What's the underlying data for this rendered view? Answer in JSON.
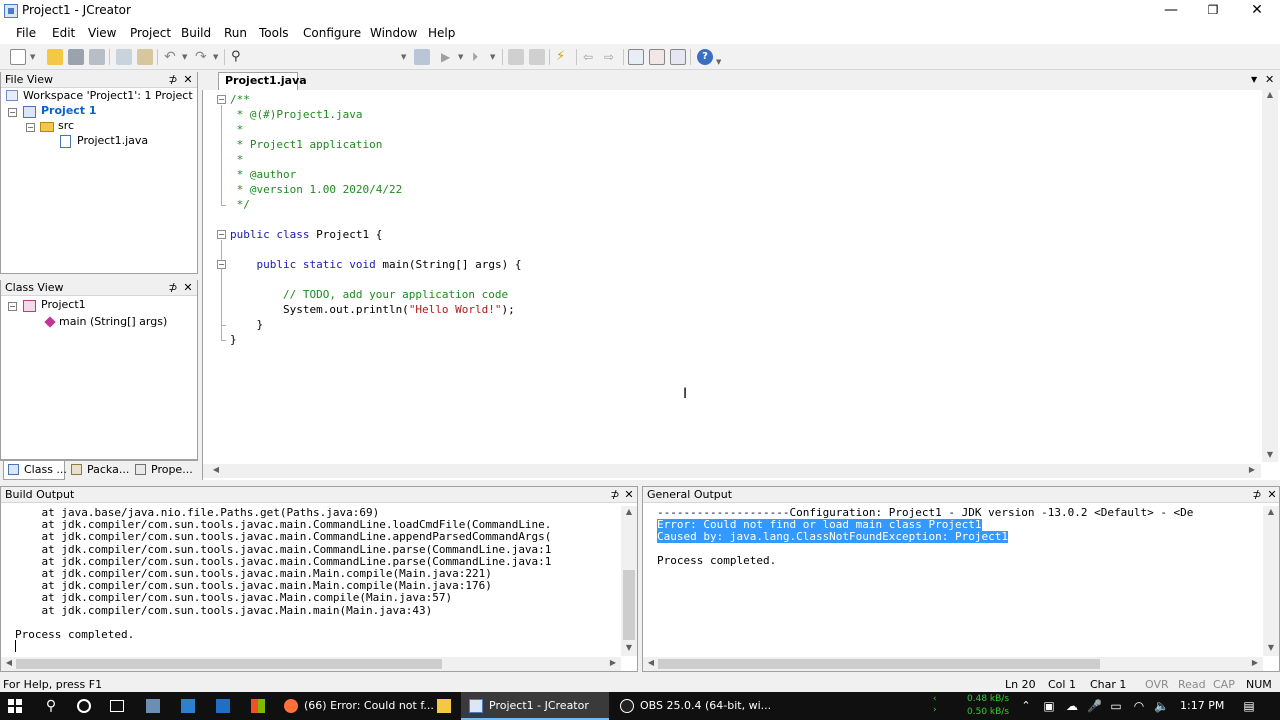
{
  "window": {
    "title": "Project1 - JCreator",
    "controls": {
      "minimize": "—",
      "restore": "❐",
      "close": "✕"
    }
  },
  "menu": [
    "File",
    "Edit",
    "View",
    "Project",
    "Build",
    "Run",
    "Tools",
    "Configure",
    "Window",
    "Help"
  ],
  "file_view": {
    "title": "File View",
    "workspace": "Workspace 'Project1': 1 Project",
    "project": "Project 1",
    "folder": "src",
    "file": "Project1.java"
  },
  "class_view": {
    "title": "Class View",
    "class_name": "Project1",
    "method": "main (String[] args)"
  },
  "left_tabs": [
    "Class ...",
    "Packa...",
    "Prope..."
  ],
  "pane_buttons": {
    "pin": "⊅",
    "close": "✕"
  },
  "editor": {
    "tab": "Project1.java",
    "lines": [
      {
        "text": "/**",
        "type": "comment"
      },
      {
        "text": " * @(#)Project1.java",
        "type": "comment"
      },
      {
        "text": " *",
        "type": "comment"
      },
      {
        "text": " * Project1 application",
        "type": "comment"
      },
      {
        "text": " *",
        "type": "comment"
      },
      {
        "text": " * @author",
        "type": "comment"
      },
      {
        "text": " * @version 1.00 2020/4/22",
        "type": "comment"
      },
      {
        "text": " */",
        "type": "comment"
      },
      {
        "text": "",
        "type": "plain"
      },
      {
        "text": "public class Project1 {",
        "type": "classdecl"
      },
      {
        "text": "",
        "type": "plain"
      },
      {
        "text": "    public static void main(String[] args) {",
        "type": "methoddecl"
      },
      {
        "text": "",
        "type": "plain"
      },
      {
        "text": "        // TODO, add your application code",
        "type": "comment"
      },
      {
        "text": "        System.out.println(\"Hello World!\");",
        "type": "println"
      },
      {
        "text": "    }",
        "type": "plain"
      },
      {
        "text": "}",
        "type": "plain"
      }
    ]
  },
  "build_output": {
    "title": "Build Output",
    "lines": [
      "    at java.base/java.nio.file.Paths.get(Paths.java:69)",
      "    at jdk.compiler/com.sun.tools.javac.main.CommandLine.loadCmdFile(CommandLine.",
      "    at jdk.compiler/com.sun.tools.javac.main.CommandLine.appendParsedCommandArgs(",
      "    at jdk.compiler/com.sun.tools.javac.main.CommandLine.parse(CommandLine.java:1",
      "    at jdk.compiler/com.sun.tools.javac.main.CommandLine.parse(CommandLine.java:1",
      "    at jdk.compiler/com.sun.tools.javac.main.Main.compile(Main.java:221)",
      "    at jdk.compiler/com.sun.tools.javac.main.Main.compile(Main.java:176)",
      "    at jdk.compiler/com.sun.tools.javac.Main.compile(Main.java:57)",
      "    at jdk.compiler/com.sun.tools.javac.Main.main(Main.java:43)",
      "",
      "Process completed."
    ]
  },
  "general_output": {
    "title": "General Output",
    "config_line": "--------------------Configuration: Project1 - JDK version -13.0.2 <Default> - <De",
    "error_line_1": "Error: Could not find or load main class Project1",
    "error_line_2": "Caused by: java.lang.ClassNotFoundException: Project1",
    "process_line": "Process completed."
  },
  "status": {
    "help": "For Help, press F1",
    "ln": "Ln 20",
    "col": "Col 1",
    "char": "Char 1",
    "ovr": "OVR",
    "read": "Read",
    "cap": "CAP",
    "num": "NUM"
  },
  "taskbar": {
    "apps": [
      "(66) Error: Could not f...",
      "Project1 - JCreator",
      "OBS 25.0.4 (64-bit, wi..."
    ],
    "net_up": "0.48 kB/s",
    "net_down": "0.50 kB/s",
    "time": "1:17 PM"
  },
  "colors": {
    "accent": "#0a64c8",
    "selection": "#3399ff",
    "comment": "#1f8a1f",
    "keyword": "#1a1ab0",
    "string": "#b01a1a",
    "taskbar": "#101010",
    "net_green": "#33cc33"
  }
}
